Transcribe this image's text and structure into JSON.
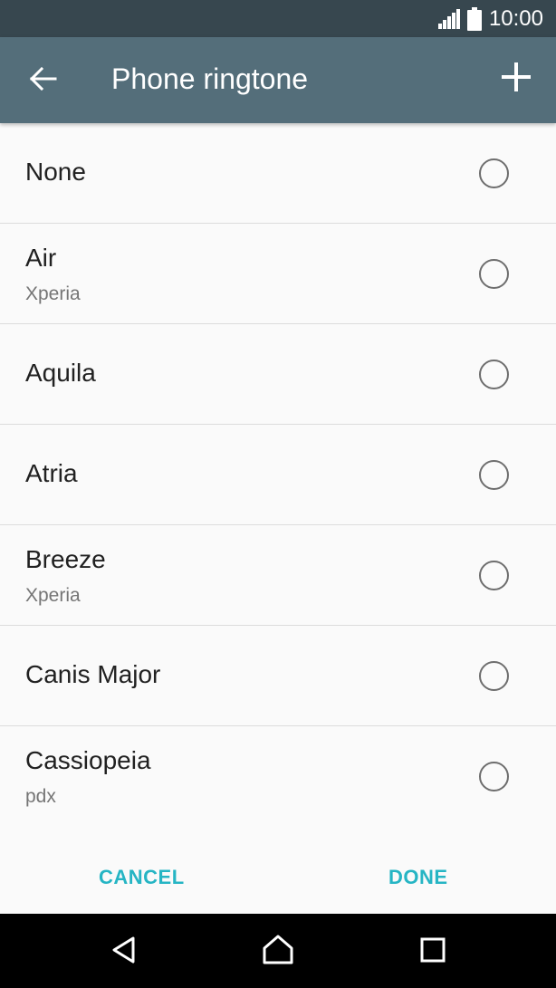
{
  "status_bar": {
    "time": "10:00",
    "icons": [
      "signal-icon",
      "battery-icon"
    ]
  },
  "toolbar": {
    "title": "Phone ringtone",
    "back_icon": "back-arrow-icon",
    "add_icon": "plus-icon"
  },
  "ringtones": [
    {
      "name": "None",
      "subtitle": "",
      "selected": false
    },
    {
      "name": "Air",
      "subtitle": "Xperia",
      "selected": false
    },
    {
      "name": "Aquila",
      "subtitle": "",
      "selected": false
    },
    {
      "name": "Atria",
      "subtitle": "",
      "selected": false
    },
    {
      "name": "Breeze",
      "subtitle": "Xperia",
      "selected": false
    },
    {
      "name": "Canis Major",
      "subtitle": "",
      "selected": false
    },
    {
      "name": "Cassiopeia",
      "subtitle": "pdx",
      "selected": false
    }
  ],
  "actions": {
    "cancel_label": "CANCEL",
    "done_label": "DONE"
  },
  "nav_bar": {
    "icons": [
      "back-triangle-icon",
      "home-icon",
      "recents-icon"
    ]
  },
  "colors": {
    "status_bar": "#37474f",
    "toolbar": "#546e7a",
    "accent": "#26b5c4",
    "background": "#fafafa"
  }
}
